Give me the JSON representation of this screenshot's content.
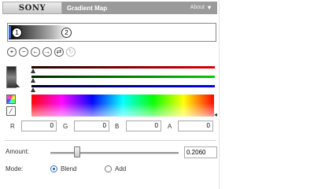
{
  "header": {
    "brand": "SONY",
    "title": "Gradient Map",
    "about": "About"
  },
  "gradient": {
    "stops": [
      "1",
      "2"
    ]
  },
  "toolbar": {
    "buttons": [
      {
        "icon": "add-stop-icon",
        "glyph": "+"
      },
      {
        "icon": "remove-stop-icon",
        "glyph": "−"
      },
      {
        "icon": "move-left-icon",
        "glyph": "←"
      },
      {
        "icon": "move-right-icon",
        "glyph": "→"
      },
      {
        "icon": "swap-icon",
        "glyph": "⇄"
      },
      {
        "icon": "reset-icon",
        "glyph": "↻"
      }
    ]
  },
  "color": {
    "r_label": "R",
    "r_value": "0",
    "g_label": "G",
    "g_value": "0",
    "b_label": "B",
    "b_value": "0",
    "a_label": "A",
    "a_value": "0"
  },
  "amount": {
    "label": "Amount:",
    "value": "0.2060",
    "fraction": 0.206
  },
  "mode": {
    "label": "Mode:",
    "options": [
      "Blend",
      "Add"
    ],
    "selected": "Blend"
  }
}
